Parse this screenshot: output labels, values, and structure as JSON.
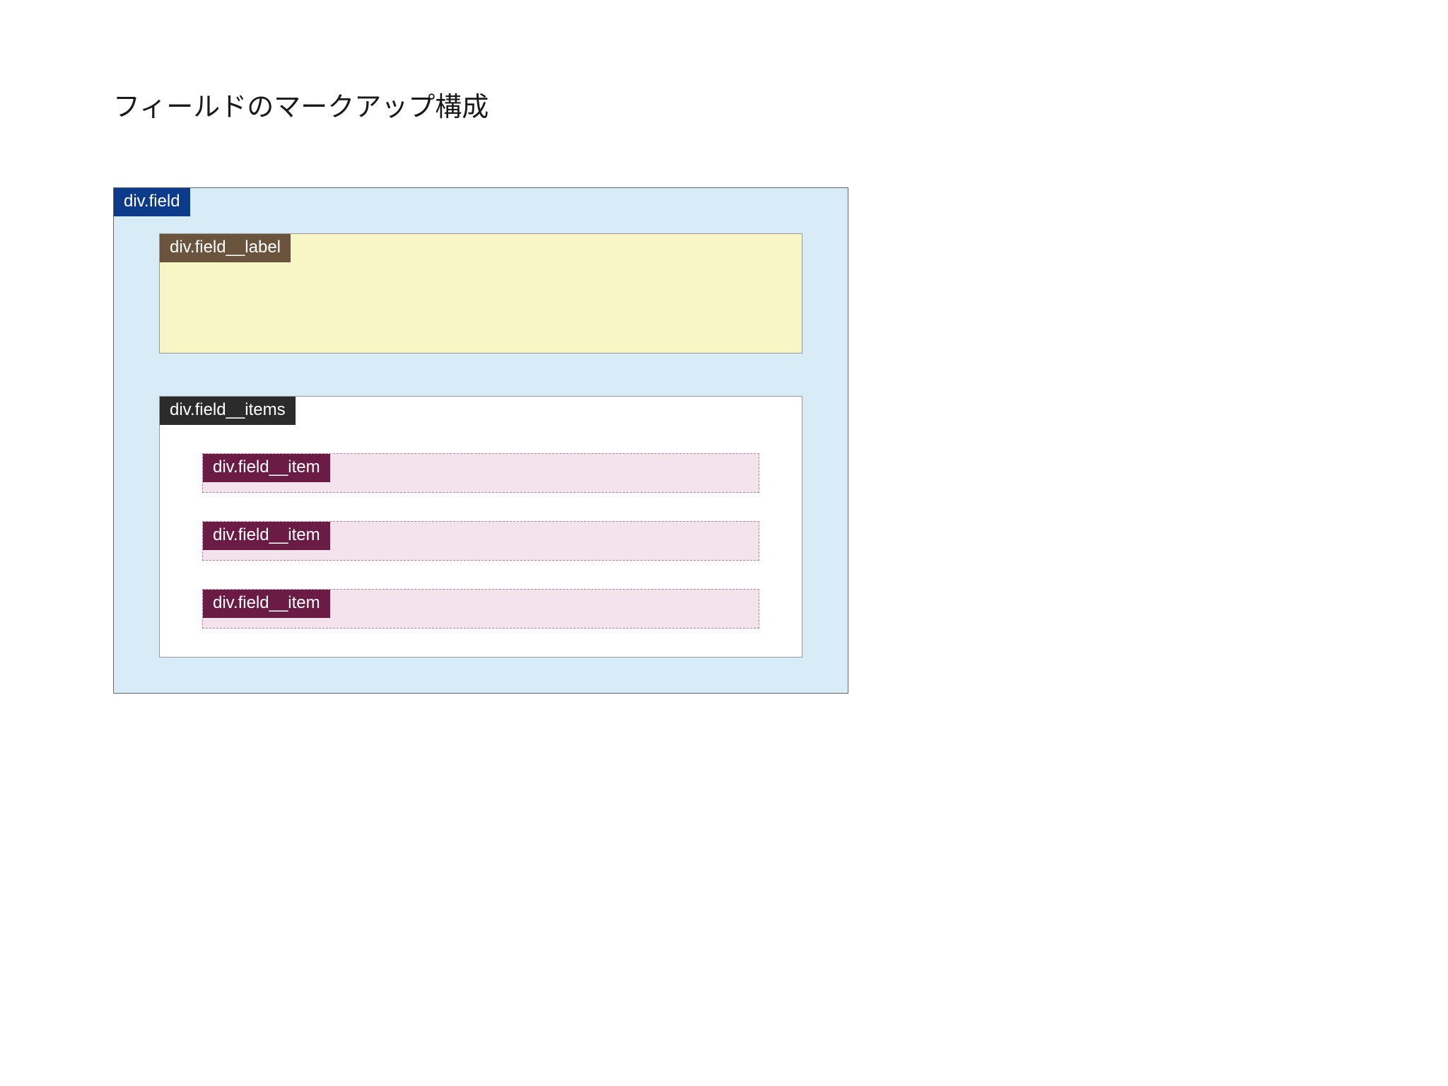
{
  "title": "フィールドのマークアップ構成",
  "boxes": {
    "field": {
      "tag": "div.field"
    },
    "label": {
      "tag": "div.field__label"
    },
    "items_container": {
      "tag": "div.field__items"
    },
    "items": [
      {
        "tag": "div.field__item"
      },
      {
        "tag": "div.field__item"
      },
      {
        "tag": "div.field__item"
      }
    ]
  }
}
